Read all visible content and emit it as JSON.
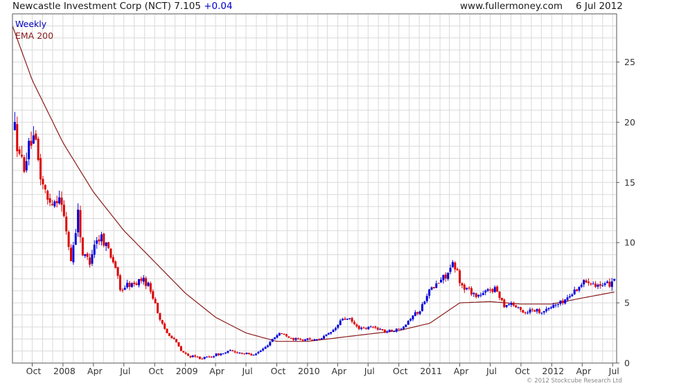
{
  "header": {
    "title": "Newcastle Investment Corp (NCT) 7.105",
    "change": "+0.04",
    "website": "www.fullermoney.com",
    "date": "6 Jul 2012"
  },
  "legend": {
    "series1": "Weekly",
    "series2": "EMA 200"
  },
  "footer": {
    "copyright": "© 2012 Stockcube Research Ltd"
  },
  "colors": {
    "up": "#0000dd",
    "down": "#dd0000",
    "ema": "#8b1a1a",
    "grid": "#d9d9d9",
    "background": "#ffffff"
  },
  "chart_data": {
    "type": "candlestick",
    "frequency": "weekly",
    "ylim": [
      0,
      29
    ],
    "yticks": [
      0,
      5,
      10,
      15,
      20,
      25
    ],
    "xlim": [
      "2007-08-03",
      "2012-07-13"
    ],
    "xticks": [
      {
        "label": "Oct",
        "date": "2007-10-01"
      },
      {
        "label": "2008",
        "date": "2008-01-01"
      },
      {
        "label": "Apr",
        "date": "2008-04-01"
      },
      {
        "label": "Jul",
        "date": "2008-07-01"
      },
      {
        "label": "Oct",
        "date": "2008-10-01"
      },
      {
        "label": "2009",
        "date": "2009-01-01"
      },
      {
        "label": "Apr",
        "date": "2009-04-01"
      },
      {
        "label": "Jul",
        "date": "2009-07-01"
      },
      {
        "label": "Oct",
        "date": "2009-10-01"
      },
      {
        "label": "2010",
        "date": "2010-01-01"
      },
      {
        "label": "Apr",
        "date": "2010-04-01"
      },
      {
        "label": "Jul",
        "date": "2010-07-01"
      },
      {
        "label": "Oct",
        "date": "2010-10-01"
      },
      {
        "label": "2011",
        "date": "2011-01-01"
      },
      {
        "label": "Apr",
        "date": "2011-04-01"
      },
      {
        "label": "Jul",
        "date": "2011-07-01"
      },
      {
        "label": "Oct",
        "date": "2011-10-01"
      },
      {
        "label": "2012",
        "date": "2012-01-01"
      },
      {
        "label": "Apr",
        "date": "2012-04-01"
      },
      {
        "label": "Jul",
        "date": "2012-07-01"
      }
    ],
    "price_path": [
      [
        "2007-08-10",
        19.5
      ],
      [
        "2007-08-24",
        17.0
      ],
      [
        "2007-09-07",
        16.5
      ],
      [
        "2007-09-28",
        18.5
      ],
      [
        "2007-10-12",
        18.0
      ],
      [
        "2007-10-26",
        15.5
      ],
      [
        "2007-11-16",
        13.5
      ],
      [
        "2007-12-07",
        13.5
      ],
      [
        "2007-12-21",
        14.0
      ],
      [
        "2008-01-11",
        11.0
      ],
      [
        "2008-01-25",
        8.5
      ],
      [
        "2008-02-15",
        12.5
      ],
      [
        "2008-02-29",
        9.0
      ],
      [
        "2008-03-21",
        8.5
      ],
      [
        "2008-04-04",
        10.0
      ],
      [
        "2008-04-25",
        10.5
      ],
      [
        "2008-05-16",
        9.5
      ],
      [
        "2008-06-06",
        8.0
      ],
      [
        "2008-06-20",
        6.0
      ],
      [
        "2008-07-11",
        6.5
      ],
      [
        "2008-08-01",
        6.5
      ],
      [
        "2008-08-22",
        7.0
      ],
      [
        "2008-09-12",
        6.5
      ],
      [
        "2008-10-03",
        5.0
      ],
      [
        "2008-10-17",
        3.5
      ],
      [
        "2008-11-07",
        2.5
      ],
      [
        "2008-11-28",
        2.0
      ],
      [
        "2008-12-19",
        1.0
      ],
      [
        "2009-01-09",
        0.6
      ],
      [
        "2009-01-30",
        0.5
      ],
      [
        "2009-02-20",
        0.4
      ],
      [
        "2009-03-13",
        0.5
      ],
      [
        "2009-04-03",
        0.7
      ],
      [
        "2009-04-24",
        0.8
      ],
      [
        "2009-05-15",
        1.0
      ],
      [
        "2009-06-05",
        0.9
      ],
      [
        "2009-06-26",
        0.8
      ],
      [
        "2009-07-17",
        0.7
      ],
      [
        "2009-08-07",
        0.9
      ],
      [
        "2009-08-28",
        1.3
      ],
      [
        "2009-09-18",
        2.0
      ],
      [
        "2009-10-09",
        2.5
      ],
      [
        "2009-10-30",
        2.3
      ],
      [
        "2009-11-20",
        2.0
      ],
      [
        "2009-12-11",
        1.9
      ],
      [
        "2010-01-01",
        2.0
      ],
      [
        "2010-01-22",
        1.9
      ],
      [
        "2010-02-12",
        2.1
      ],
      [
        "2010-03-05",
        2.4
      ],
      [
        "2010-03-26",
        2.9
      ],
      [
        "2010-04-16",
        3.7
      ],
      [
        "2010-05-07",
        3.6
      ],
      [
        "2010-05-28",
        3.0
      ],
      [
        "2010-06-18",
        2.8
      ],
      [
        "2010-07-09",
        3.0
      ],
      [
        "2010-07-30",
        2.9
      ],
      [
        "2010-08-20",
        2.6
      ],
      [
        "2010-09-10",
        2.7
      ],
      [
        "2010-10-01",
        2.8
      ],
      [
        "2010-10-22",
        3.3
      ],
      [
        "2010-11-12",
        4.0
      ],
      [
        "2010-12-03",
        4.3
      ],
      [
        "2010-12-24",
        5.8
      ],
      [
        "2011-01-14",
        6.3
      ],
      [
        "2011-02-04",
        6.9
      ],
      [
        "2011-02-25",
        7.5
      ],
      [
        "2011-03-11",
        8.1
      ],
      [
        "2011-03-25",
        7.5
      ],
      [
        "2011-04-08",
        6.3
      ],
      [
        "2011-04-29",
        6.1
      ],
      [
        "2011-05-20",
        5.6
      ],
      [
        "2011-06-10",
        5.7
      ],
      [
        "2011-07-01",
        6.2
      ],
      [
        "2011-07-22",
        6.0
      ],
      [
        "2011-08-12",
        4.8
      ],
      [
        "2011-09-02",
        5.0
      ],
      [
        "2011-09-23",
        4.5
      ],
      [
        "2011-10-14",
        4.2
      ],
      [
        "2011-11-04",
        4.5
      ],
      [
        "2011-11-25",
        4.3
      ],
      [
        "2011-12-16",
        4.4
      ],
      [
        "2012-01-06",
        4.8
      ],
      [
        "2012-01-27",
        5.0
      ],
      [
        "2012-02-17",
        5.4
      ],
      [
        "2012-03-09",
        6.0
      ],
      [
        "2012-03-30",
        6.6
      ],
      [
        "2012-04-20",
        6.9
      ],
      [
        "2012-05-11",
        6.6
      ],
      [
        "2012-06-01",
        6.3
      ],
      [
        "2012-06-22",
        6.6
      ],
      [
        "2012-07-06",
        7.1
      ]
    ],
    "ema200": [
      [
        "2007-08-03",
        28.0
      ],
      [
        "2007-10-01",
        23.5
      ],
      [
        "2008-01-01",
        18.3
      ],
      [
        "2008-04-01",
        14.2
      ],
      [
        "2008-07-01",
        11.0
      ],
      [
        "2008-10-01",
        8.4
      ],
      [
        "2009-01-01",
        5.8
      ],
      [
        "2009-04-01",
        3.8
      ],
      [
        "2009-07-01",
        2.5
      ],
      [
        "2009-10-01",
        1.8
      ],
      [
        "2010-01-01",
        1.8
      ],
      [
        "2010-04-01",
        2.1
      ],
      [
        "2010-07-01",
        2.4
      ],
      [
        "2010-10-01",
        2.7
      ],
      [
        "2011-01-01",
        3.3
      ],
      [
        "2011-04-01",
        5.0
      ],
      [
        "2011-07-01",
        5.1
      ],
      [
        "2011-10-01",
        4.9
      ],
      [
        "2012-01-01",
        4.9
      ],
      [
        "2012-04-01",
        5.4
      ],
      [
        "2012-07-06",
        5.9
      ]
    ]
  }
}
